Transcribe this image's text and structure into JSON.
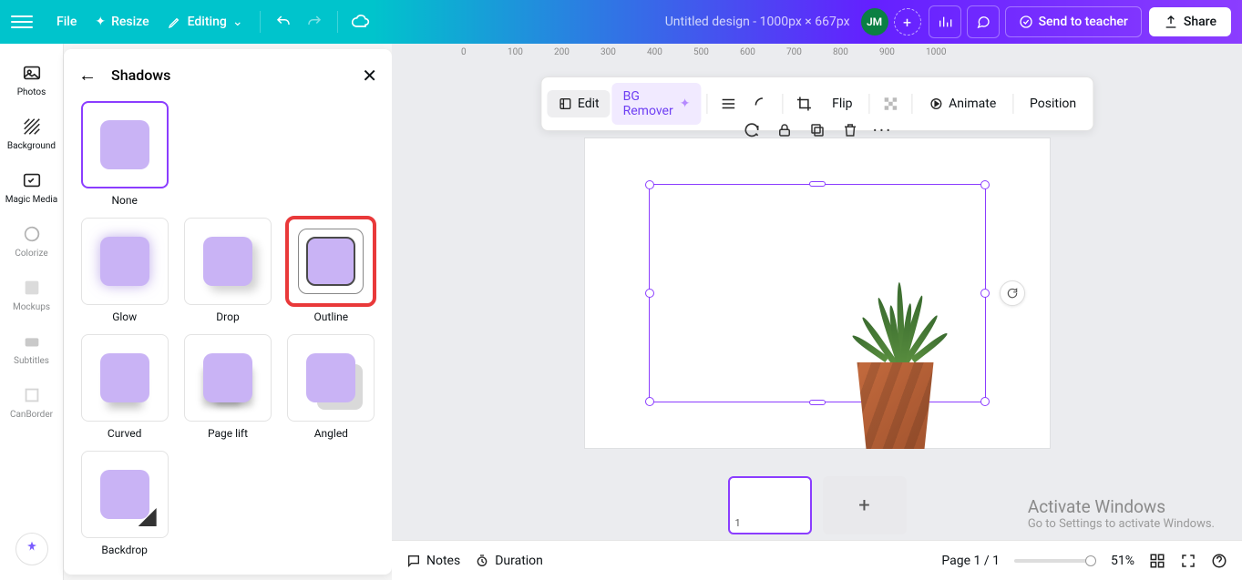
{
  "topbar": {
    "file": "File",
    "resize": "Resize",
    "editing": "Editing",
    "doc_title": "Untitled design - 1000px × 667px",
    "avatar_initials": "JM",
    "send_to_teacher": "Send to teacher",
    "share": "Share"
  },
  "leftnav": {
    "photos": "Photos",
    "background": "Background",
    "magic_media": "Magic Media",
    "colorize": "Colorize",
    "mockups": "Mockups",
    "subtitles": "Subtitles",
    "canborder": "CanBorder"
  },
  "panel": {
    "title": "Shadows",
    "options": {
      "none": "None",
      "glow": "Glow",
      "drop": "Drop",
      "outline": "Outline",
      "curved": "Curved",
      "page_lift": "Page lift",
      "angled": "Angled",
      "backdrop": "Backdrop"
    }
  },
  "context_toolbar": {
    "edit": "Edit",
    "bg_remover": "BG Remover",
    "flip": "Flip",
    "animate": "Animate",
    "position": "Position"
  },
  "ruler": {
    "ticks": [
      "0",
      "100",
      "200",
      "300",
      "400",
      "500",
      "600",
      "700",
      "800",
      "900",
      "1000"
    ]
  },
  "footer": {
    "notes": "Notes",
    "duration": "Duration",
    "page_indicator": "Page 1 / 1",
    "zoom": "51%"
  },
  "page_thumb": {
    "number": "1",
    "add": "+"
  },
  "watermark": {
    "line1": "Activate Windows",
    "line2": "Go to Settings to activate Windows."
  }
}
